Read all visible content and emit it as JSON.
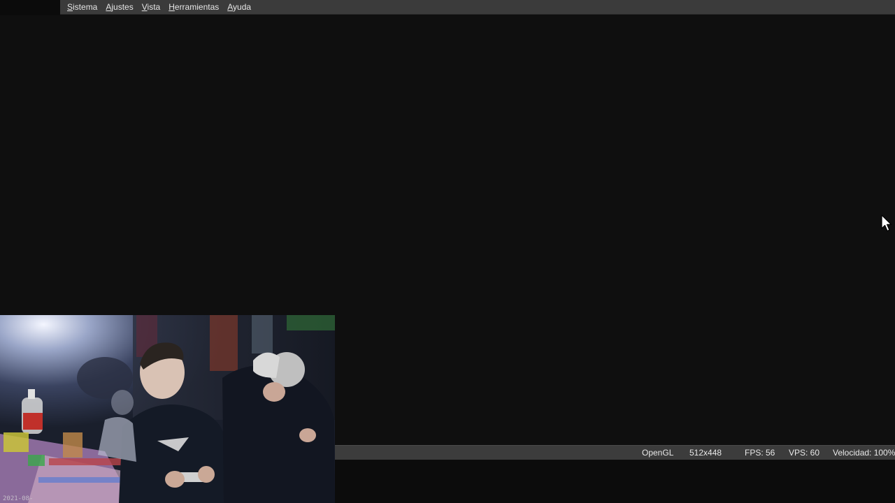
{
  "menu": {
    "items": [
      {
        "id": "sistema",
        "mnemonic": "S",
        "rest": "istema"
      },
      {
        "id": "ajustes",
        "mnemonic": "A",
        "rest": "justes"
      },
      {
        "id": "vista",
        "mnemonic": "V",
        "rest": "ista"
      },
      {
        "id": "herramientas",
        "mnemonic": "H",
        "rest": "erramientas"
      },
      {
        "id": "ayuda",
        "mnemonic": "A",
        "rest": "yuda"
      }
    ]
  },
  "statusbar": {
    "renderer": "OpenGL",
    "resolution": "512x448",
    "fps": "FPS: 56",
    "vps": "VPS: 60",
    "speed": "Velocidad: 100%"
  },
  "webcam": {
    "timestamp": "2021-08-"
  },
  "colors": {
    "menubar_bg": "#3b3b3b",
    "statusbar_bg": "#3c3c3c",
    "screen_bg": "#0f0f0f",
    "text": "#e6e6e6"
  },
  "icons": {
    "cursor": "mouse-pointer-icon"
  }
}
